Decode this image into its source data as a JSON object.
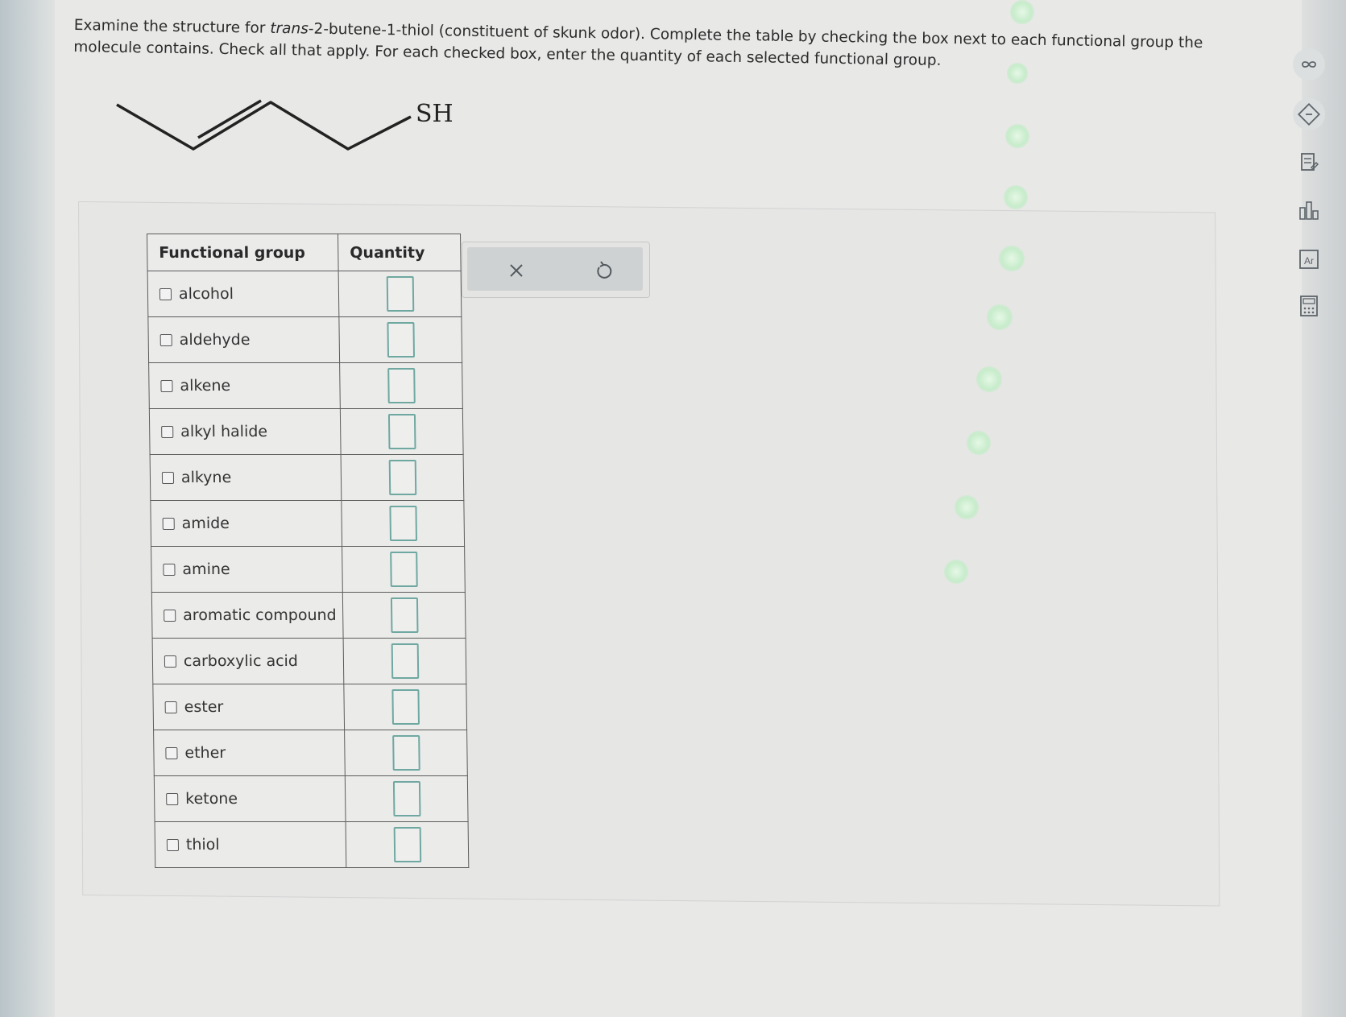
{
  "question": {
    "part1": "Examine the structure for ",
    "italic": "trans",
    "part2": "-2-butene-1-thiol (constituent of skunk odor). Complete the table by checking the box next to each functional group the molecule contains. Check all that apply. For each checked box, enter the quantity of each selected functional group."
  },
  "molecule": {
    "label": "SH"
  },
  "table": {
    "headers": {
      "group": "Functional group",
      "quantity": "Quantity"
    },
    "rows": [
      {
        "label": "alcohol",
        "checked": false,
        "quantity": ""
      },
      {
        "label": "aldehyde",
        "checked": false,
        "quantity": ""
      },
      {
        "label": "alkene",
        "checked": false,
        "quantity": ""
      },
      {
        "label": "alkyl halide",
        "checked": false,
        "quantity": ""
      },
      {
        "label": "alkyne",
        "checked": false,
        "quantity": ""
      },
      {
        "label": "amide",
        "checked": false,
        "quantity": ""
      },
      {
        "label": "amine",
        "checked": false,
        "quantity": ""
      },
      {
        "label": "aromatic compound",
        "checked": false,
        "quantity": ""
      },
      {
        "label": "carboxylic acid",
        "checked": false,
        "quantity": ""
      },
      {
        "label": "ester",
        "checked": false,
        "quantity": ""
      },
      {
        "label": "ether",
        "checked": false,
        "quantity": ""
      },
      {
        "label": "ketone",
        "checked": false,
        "quantity": ""
      },
      {
        "label": "thiol",
        "checked": false,
        "quantity": ""
      }
    ]
  },
  "actions": {
    "clear_icon": "close-icon",
    "reset_icon": "undo-icon"
  },
  "toolbar": {
    "icons": [
      "infinity-icon",
      "hint-icon",
      "notes-icon",
      "chart-icon",
      "periodic-table-icon",
      "calculator-icon"
    ]
  },
  "colors": {
    "input_border": "#6fa8a1",
    "table_border": "#5c5c5c",
    "page_bg": "#e8e8e7"
  }
}
